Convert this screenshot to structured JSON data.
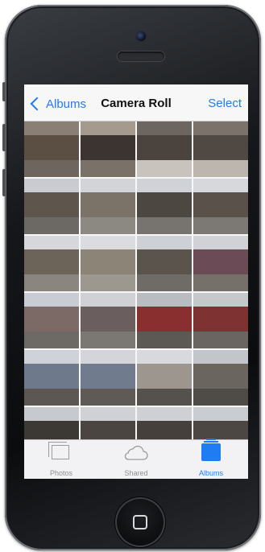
{
  "navbar": {
    "back_label": "Albums",
    "title": "Camera Roll",
    "select_label": "Select"
  },
  "tabs": [
    {
      "label": "Photos",
      "icon": "photos-icon",
      "active": false
    },
    {
      "label": "Shared",
      "icon": "cloud-icon",
      "active": false
    },
    {
      "label": "Albums",
      "icon": "albums-icon",
      "active": true
    }
  ],
  "colors": {
    "accent": "#1f7cf2",
    "inactive": "#8e8e93"
  },
  "photos": [
    {
      "sky": "#8a7f74",
      "bld": "#5b4f44",
      "gnd": "#6e655e"
    },
    {
      "sky": "#a59a8e",
      "bld": "#3c3430",
      "gnd": "#7a7169"
    },
    {
      "sky": "#6d655f",
      "bld": "#4a433e",
      "gnd": "#c9c3bd"
    },
    {
      "sky": "#7b736b",
      "bld": "#504842",
      "gnd": "#bdb6ae"
    },
    {
      "sky": "#c8cbd0",
      "bld": "#5e564d",
      "gnd": "#6c6863"
    },
    {
      "sky": "#d2d4d8",
      "bld": "#7b7268",
      "gnd": "#8c8882"
    },
    {
      "sky": "#cfd2d6",
      "bld": "#4d4741",
      "gnd": "#77736e"
    },
    {
      "sky": "#d6d8db",
      "bld": "#5a524a",
      "gnd": "#7c7873"
    },
    {
      "sky": "#d5d7da",
      "bld": "#6c6359",
      "gnd": "#8a857f"
    },
    {
      "sky": "#dadcdf",
      "bld": "#8d8478",
      "gnd": "#9c978f"
    },
    {
      "sky": "#cdd0d4",
      "bld": "#5b544c",
      "gnd": "#6f6b66"
    },
    {
      "sky": "#d0d2d6",
      "bld": "#6a4b56",
      "gnd": "#75706a"
    },
    {
      "sky": "#c9ccd2",
      "bld": "#7c6a66",
      "gnd": "#6d6a66"
    },
    {
      "sky": "#cfd1d5",
      "bld": "#6b5e5e",
      "gnd": "#7b7772"
    },
    {
      "sky": "#b9bcc1",
      "bld": "#8a2f2f",
      "gnd": "#5c5854"
    },
    {
      "sky": "#c6c8cc",
      "bld": "#7e3232",
      "gnd": "#6a6560"
    },
    {
      "sky": "#cfd2d8",
      "bld": "#6e7a8c",
      "gnd": "#5c5752"
    },
    {
      "sky": "#d3d5da",
      "bld": "#707c8e",
      "gnd": "#5f5a55"
    },
    {
      "sky": "#d7d9dc",
      "bld": "#9c968e",
      "gnd": "#55514d"
    },
    {
      "sky": "#c2c5ca",
      "bld": "#6a655f",
      "gnd": "#4f4b47"
    },
    {
      "sky": "#c6c9ce",
      "bld": "#3c3834",
      "gnd": "#5e5a56"
    },
    {
      "sky": "#cfd1d5",
      "bld": "#4a4540",
      "gnd": "#6c6864"
    },
    {
      "sky": "#ced0d4",
      "bld": "#45403b",
      "gnd": "#65615d"
    },
    {
      "sky": "#c9ccd0",
      "bld": "#4c4742",
      "gnd": "#6a6662"
    }
  ]
}
